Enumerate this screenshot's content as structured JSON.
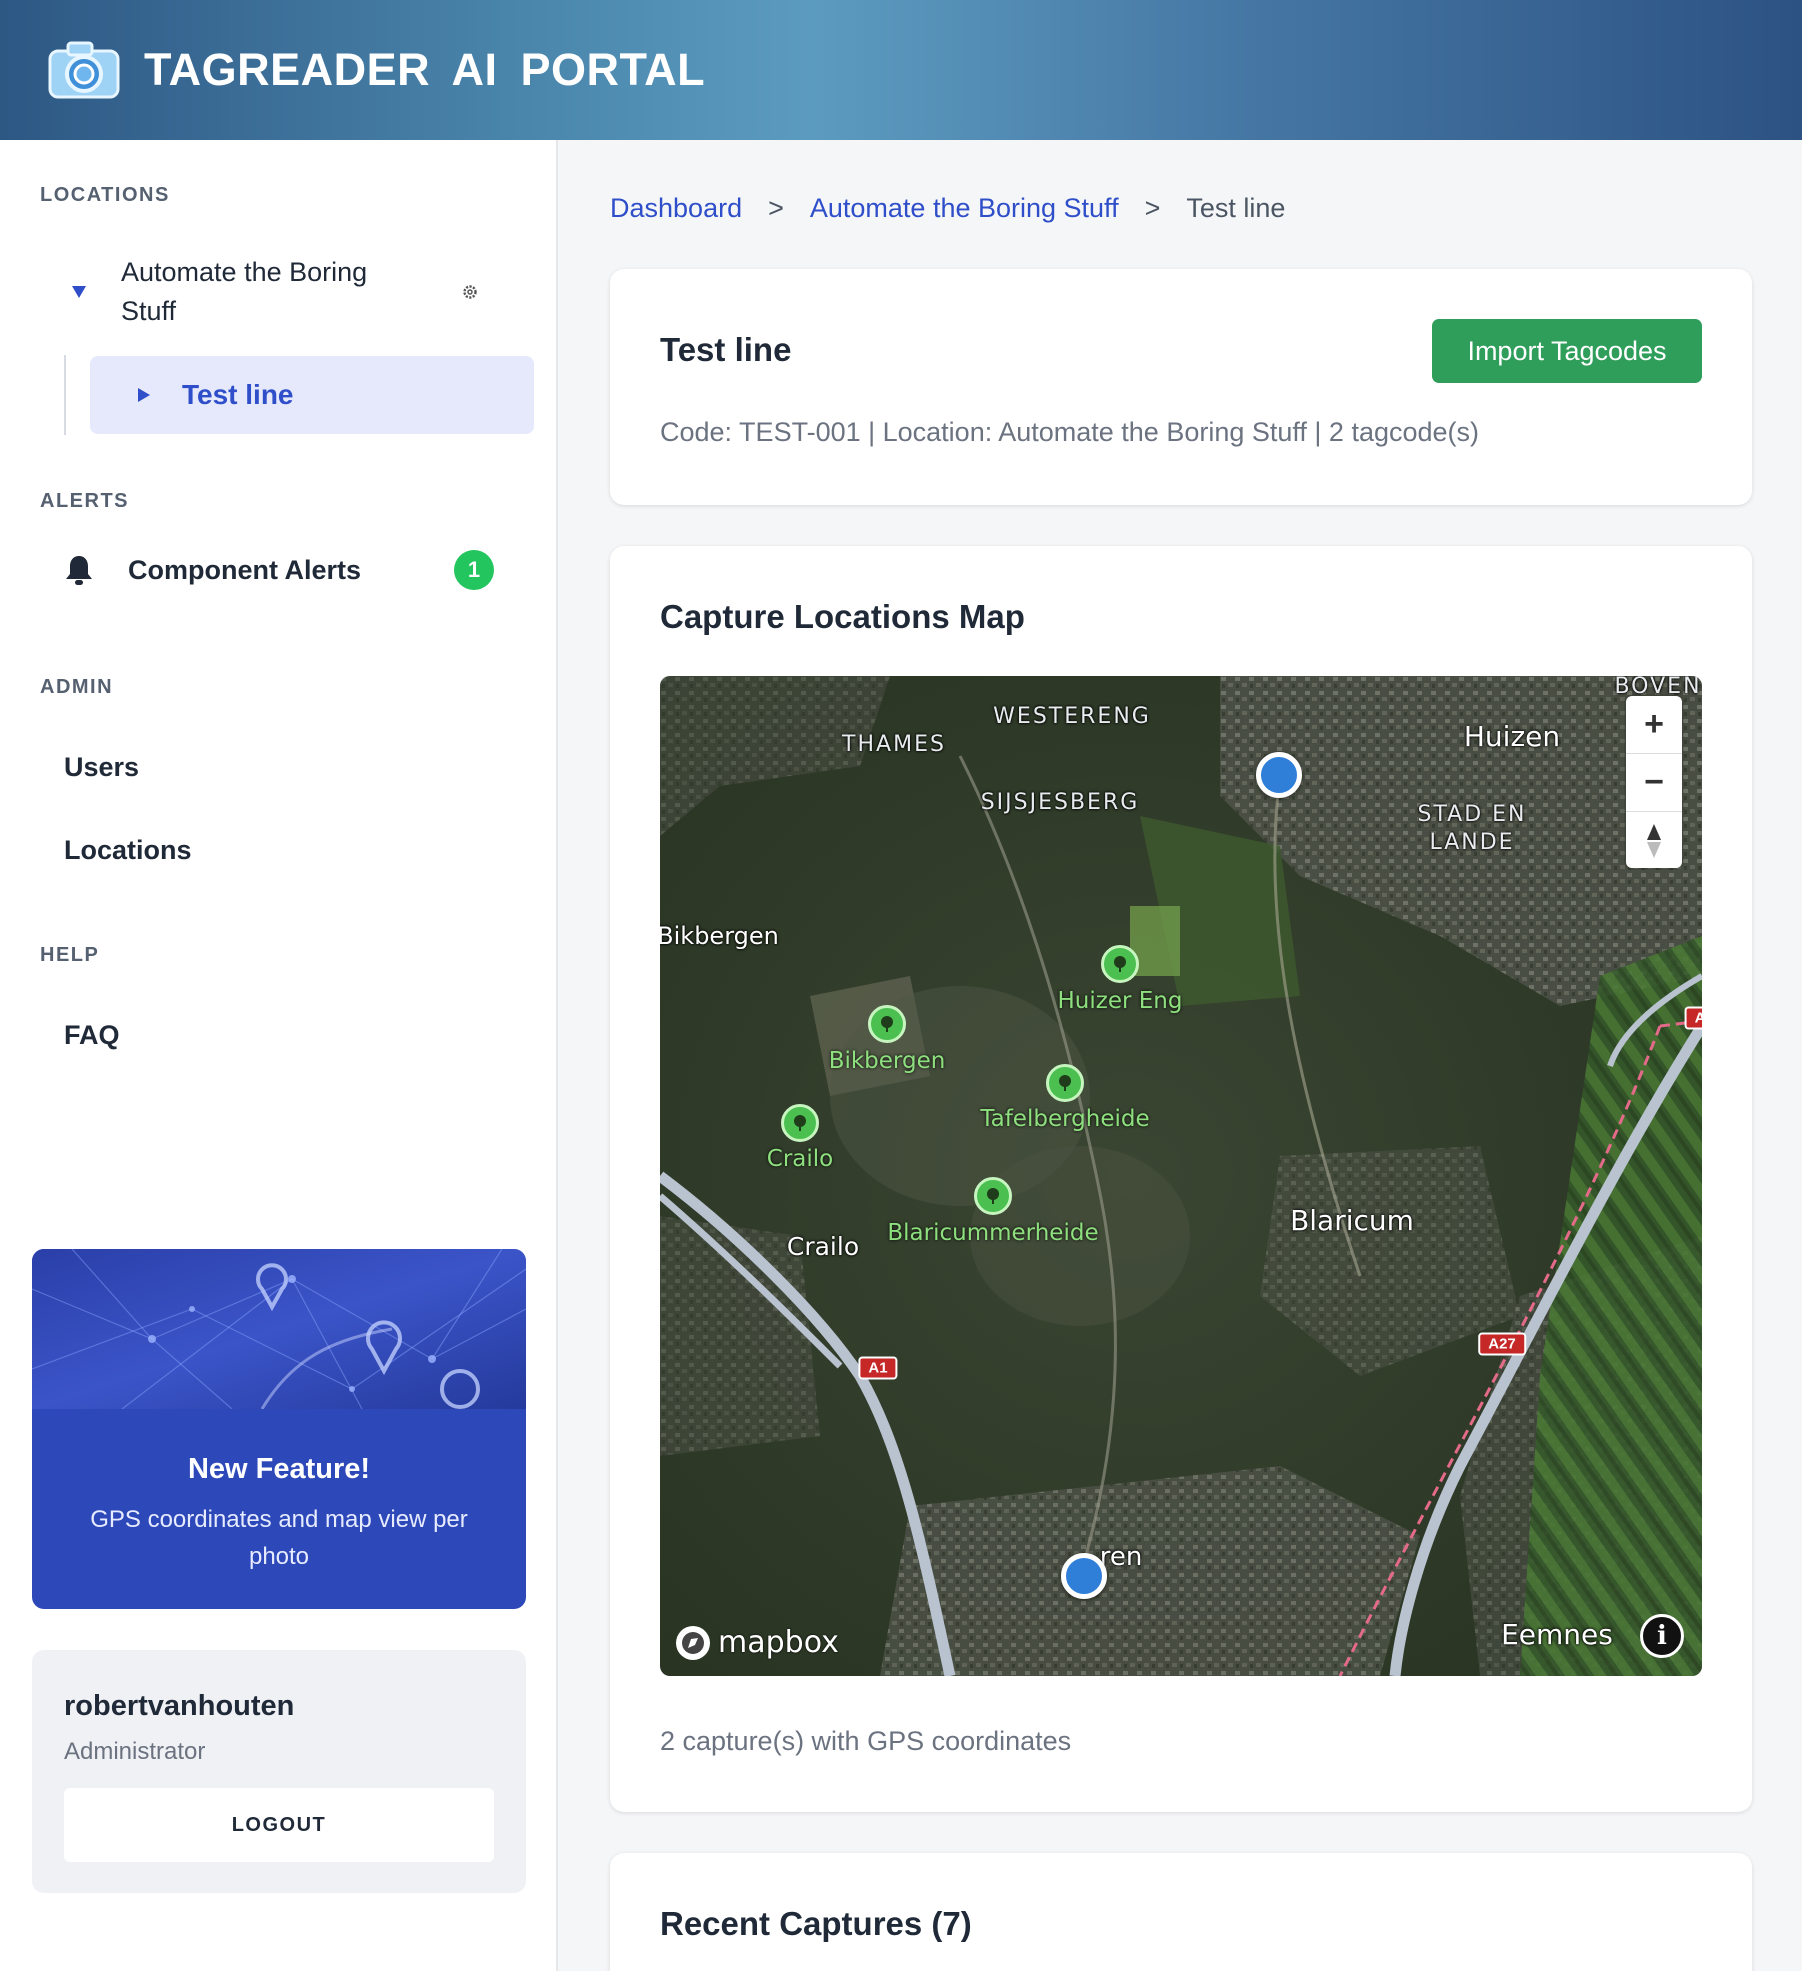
{
  "header": {
    "title": "TAGREADER AI PORTAL"
  },
  "sidebar": {
    "sections": {
      "locations": "LOCATIONS",
      "alerts": "ALERTS",
      "admin": "ADMIN",
      "help": "HELP"
    },
    "tree": {
      "parent": "Automate the Boring Stuff",
      "child": "Test line"
    },
    "alerts": {
      "label": "Component Alerts",
      "count": "1"
    },
    "admin_links": [
      "Users",
      "Locations"
    ],
    "help_links": [
      "FAQ"
    ],
    "promo": {
      "title": "New Feature!",
      "text": "GPS coordinates and map view per photo"
    },
    "user": {
      "name": "robertvanhouten",
      "role": "Administrator",
      "logout_label": "LOGOUT"
    }
  },
  "breadcrumb": {
    "items": [
      "Dashboard",
      "Automate the Boring Stuff",
      "Test line"
    ],
    "separator": ">"
  },
  "line_card": {
    "title": "Test line",
    "import_label": "Import Tagcodes",
    "meta": "Code: TEST-001 | Location: Automate the Boring Stuff | 2 tagcode(s)"
  },
  "map_card": {
    "title": "Capture Locations Map",
    "footer": "2 capture(s) with GPS coordinates",
    "map": {
      "places": {
        "huizen": "Huizen",
        "blaricum": "Blaricum",
        "eemnes": "Eemnes",
        "crailo_town": "Crailo",
        "bikbergen_edge": "Bikbergen",
        "laren_partial": "ren",
        "westereng": "WESTERENG",
        "thames": "THAMES",
        "sijsjesberg": "SIJSJESBERG",
        "stad_en_lande": "STAD EN",
        "stad_en_lande_2": "LANDE",
        "boven": "BOVEN"
      },
      "parks": {
        "huizer_eng": "Huizer Eng",
        "bikbergen": "Bikbergen",
        "tafelbergheide": "Tafelbergheide",
        "crailo": "Crailo",
        "blaricummerheide": "Blaricummerheide"
      },
      "roads": {
        "a1": "A1",
        "a27": "A27",
        "a_edge": "A"
      },
      "zoom_in": "+",
      "zoom_out": "−",
      "compass": "▲",
      "attribution_logo": "mapbox",
      "info": "i"
    }
  },
  "captures_card": {
    "title": "Recent Captures (7)"
  }
}
